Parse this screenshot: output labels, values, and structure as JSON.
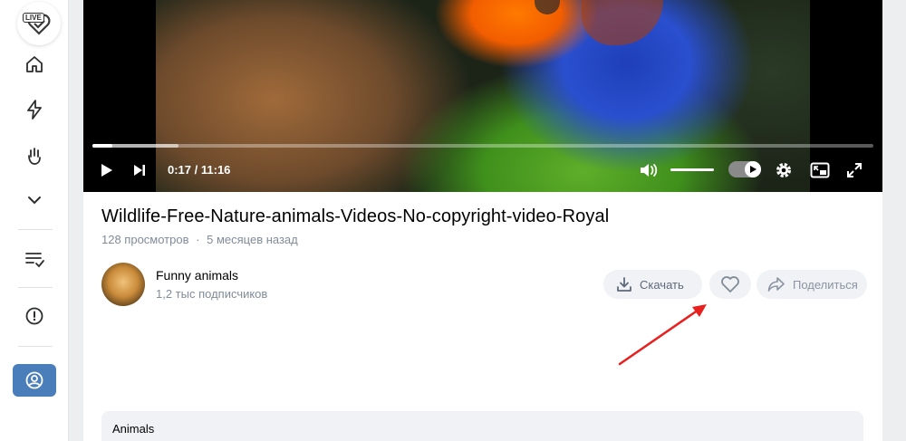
{
  "sidebar": {
    "logo_text": "LIVE",
    "items": [
      {
        "icon": "home-icon"
      },
      {
        "icon": "lightning-icon"
      },
      {
        "icon": "hand-wave-icon"
      },
      {
        "icon": "chevron-down-icon"
      },
      {
        "icon": "playlist-check-icon"
      },
      {
        "icon": "alert-circle-icon"
      },
      {
        "icon": "profile-icon"
      }
    ],
    "accent_color": "#4a7ebb"
  },
  "player": {
    "current_time": "0:17",
    "separator": " / ",
    "duration": "11:16",
    "progress_fraction": 0.025,
    "buffer_fraction": 0.11,
    "volume_fraction": 1.0,
    "toggle_on": true
  },
  "video": {
    "title": "Wildlife-Free-Nature-animals-Videos-No-copyright-video-Royal",
    "views": "128 просмотров",
    "dot": "·",
    "age": "5 месяцев назад"
  },
  "channel": {
    "name": "Funny animals",
    "subscribers": "1,2 тыс подписчиков"
  },
  "actions": {
    "download_label": "Скачать",
    "share_label": "Поделиться"
  },
  "tags": {
    "label": "Animals"
  },
  "annotation": {
    "arrow_color": "#e8201e"
  }
}
